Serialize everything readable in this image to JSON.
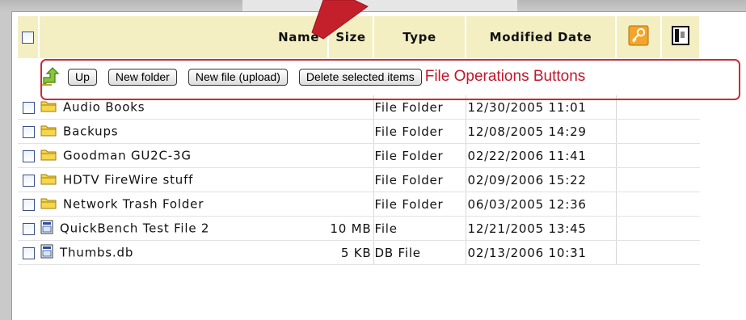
{
  "columns": {
    "name": "Name",
    "size": "Size",
    "type": "Type",
    "modified": "Modified Date"
  },
  "header_icons": [
    "permissions-key-icon",
    "properties-icon"
  ],
  "toolbar": {
    "up_label": "Up",
    "new_folder_label": "New folder",
    "new_file_label": "New file (upload)",
    "delete_label": "Delete selected items",
    "callout_label": "File Operations Buttons"
  },
  "files": [
    {
      "name": "Audio Books",
      "size": "",
      "type": "File Folder",
      "modified": "12/30/2005 11:01",
      "icon": "folder-icon"
    },
    {
      "name": "Backups",
      "size": "",
      "type": "File Folder",
      "modified": "12/08/2005 14:29",
      "icon": "folder-icon"
    },
    {
      "name": "Goodman GU2C-3G",
      "size": "",
      "type": "File Folder",
      "modified": "02/22/2006 11:41",
      "icon": "folder-icon"
    },
    {
      "name": "HDTV FireWire stuff",
      "size": "",
      "type": "File Folder",
      "modified": "02/09/2006 15:22",
      "icon": "folder-icon"
    },
    {
      "name": "Network Trash Folder",
      "size": "",
      "type": "File Folder",
      "modified": "06/03/2005 12:36",
      "icon": "folder-icon"
    },
    {
      "name": "QuickBench Test File 2",
      "size": "10 MB",
      "type": "File",
      "modified": "12/21/2005 13:45",
      "icon": "file-icon"
    },
    {
      "name": "Thumbs.db",
      "size": "5 KB",
      "type": "DB File",
      "modified": "02/13/2006 10:31",
      "icon": "file-icon"
    }
  ],
  "colors": {
    "header_bg": "#f4efc3",
    "callout_red": "#cc2b37",
    "checkbox_border": "#3c4f86"
  }
}
